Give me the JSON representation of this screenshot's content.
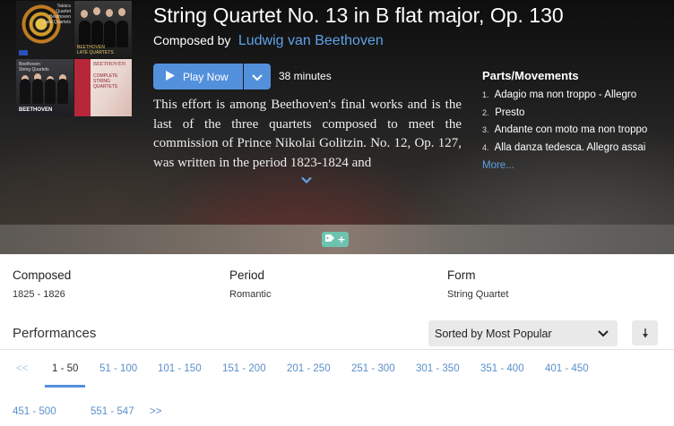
{
  "work": {
    "title": "String Quartet No. 13 in B flat major, Op. 130",
    "composed_by_label": "Composed by",
    "composer": "Ludwig van Beethoven",
    "duration": "38 minutes",
    "description": "This effort is among Beethoven's final works and is the last of the three quartets composed to meet the commission of Prince Nikolai Golitzin. No. 12, Op. 127, was written in the period 1823-1824 and"
  },
  "play": {
    "label": "Play Now"
  },
  "albums": [
    {
      "title_lines": [
        "Takács",
        "Quartet",
        "Beethoven",
        "Late Quartets"
      ]
    },
    {
      "title_lines": [
        "BEETHOVEN",
        "LATE QUARTETS"
      ]
    },
    {
      "title": "BEETHOVEN",
      "top_lines": [
        "Beethoven",
        "String Quartets"
      ]
    },
    {
      "name": "BEETHOVEN",
      "sub_lines": [
        "COMPLETE",
        "STRING",
        "QUARTETS"
      ]
    }
  ],
  "parts": {
    "heading": "Parts/Movements",
    "items": [
      {
        "num": "1.",
        "label": "Adagio ma non troppo - Allegro"
      },
      {
        "num": "2.",
        "label": "Presto"
      },
      {
        "num": "3.",
        "label": "Andante con moto ma non troppo"
      },
      {
        "num": "4.",
        "label": "Alla danza tedesca. Allegro assai"
      }
    ],
    "more": "More..."
  },
  "tag_button": {
    "plus": "+"
  },
  "info": {
    "composed": {
      "label": "Composed",
      "value": "1825 - 1826"
    },
    "period": {
      "label": "Period",
      "value": "Romantic"
    },
    "form": {
      "label": "Form",
      "value": "String Quartet"
    }
  },
  "performances": {
    "heading": "Performances",
    "sort_label": "Sorted by Most Popular",
    "pages_row1": [
      "<<",
      "1 - 50",
      "51 - 100",
      "101 - 150",
      "151 - 200",
      "201 - 250",
      "251 - 300",
      "301 - 350",
      "351 - 400",
      "401 - 450"
    ],
    "pages_row2": [
      "451 - 500",
      "551 - 547",
      ">>"
    ]
  },
  "colors": {
    "accent_blue": "#5390dc",
    "link_blue": "#5ea2e6",
    "tag_teal": "#6ec3b0"
  }
}
